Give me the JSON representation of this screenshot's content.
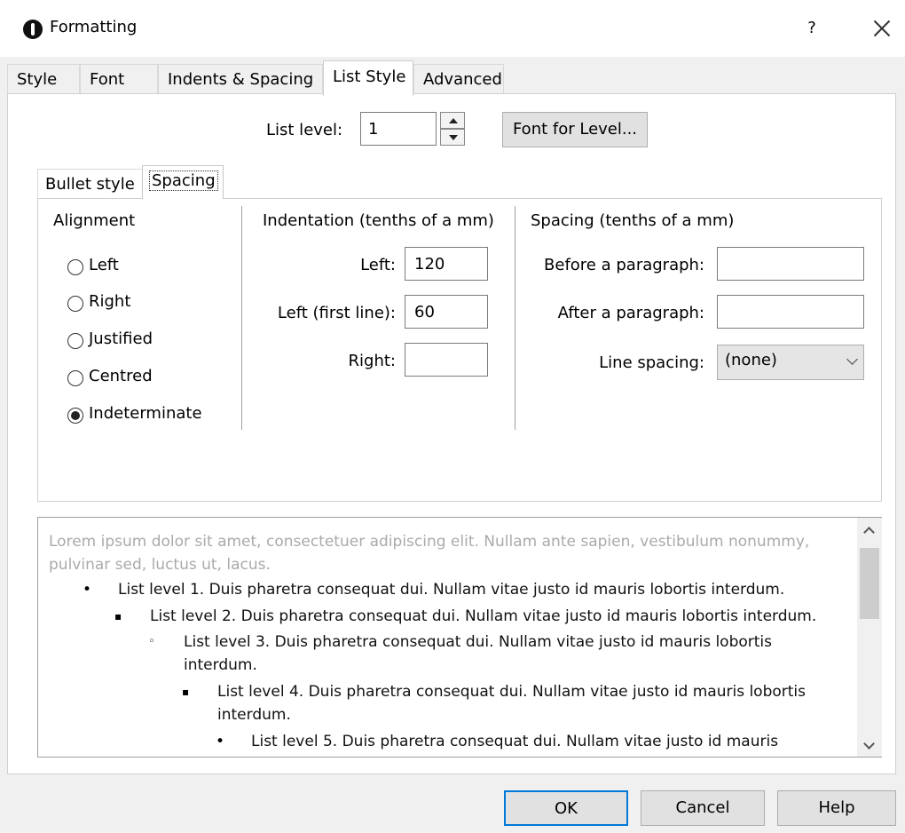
{
  "window": {
    "title": "Formatting",
    "help_glyph": "?"
  },
  "tabs": [
    "Style",
    "Font",
    "Indents & Spacing",
    "List Style",
    "Advanced"
  ],
  "active_tab": "List Style",
  "list_level": {
    "label": "List level:",
    "value": "1"
  },
  "font_for_level_button": "Font for Level...",
  "subtabs": [
    "Bullet style",
    "Spacing"
  ],
  "active_subtab": "Spacing",
  "alignment": {
    "title": "Alignment",
    "options": [
      "Left",
      "Right",
      "Justified",
      "Centred",
      "Indeterminate"
    ],
    "selected": "Indeterminate"
  },
  "indentation": {
    "title": "Indentation (tenths of a mm)",
    "left_label": "Left:",
    "left_value": "120",
    "first_line_label": "Left (first line):",
    "first_line_value": "60",
    "right_label": "Right:",
    "right_value": ""
  },
  "spacing": {
    "title": "Spacing (tenths of a mm)",
    "before_label": "Before a paragraph:",
    "before_value": "",
    "after_label": "After a paragraph:",
    "after_value": "",
    "line_spacing_label": "Line spacing:",
    "line_spacing_value": "(none)"
  },
  "preview": {
    "lorem": "Lorem ipsum dolor sit amet, consectetuer adipiscing elit. Nullam ante sapien, vestibulum nonummy, pulvinar sed, luctus ut, lacus.",
    "items": [
      {
        "bullet": "•",
        "text": "List level 1. Duis pharetra consequat dui. Nullam vitae justo id mauris lobortis interdum."
      },
      {
        "bullet": "▪",
        "text": "List level 2. Duis pharetra consequat dui. Nullam vitae justo id mauris lobortis interdum."
      },
      {
        "bullet": "◦",
        "text": "List level 3. Duis pharetra consequat dui. Nullam vitae justo id mauris lobortis interdum."
      },
      {
        "bullet": "▪",
        "text": "List level 4. Duis pharetra consequat dui. Nullam vitae justo id mauris lobortis interdum."
      },
      {
        "bullet": "•",
        "text": "List level 5. Duis pharetra consequat dui. Nullam vitae justo id mauris"
      }
    ]
  },
  "buttons": {
    "ok": "OK",
    "cancel": "Cancel",
    "help": "Help"
  }
}
